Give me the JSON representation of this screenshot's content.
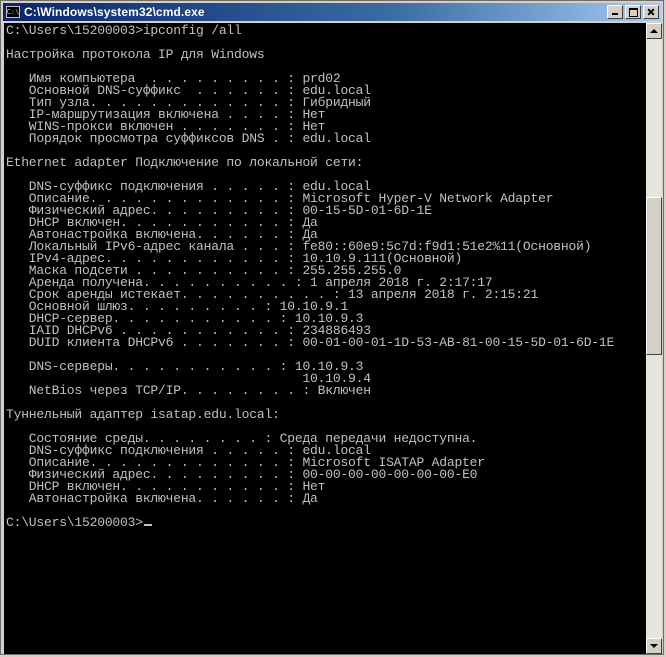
{
  "window": {
    "title": "C:\\Windows\\system32\\cmd.exe",
    "icon_text": "C:\\",
    "buttons": {
      "minimize": "minimize-icon",
      "maximize": "maximize-icon",
      "close": "close-icon"
    }
  },
  "colors": {
    "console_bg": "#000000",
    "console_text": "#c0c0c0",
    "titlebar": "#0a246a"
  },
  "terminal": {
    "prompt_command": "C:\\Users\\15200003>ipconfig /all",
    "output": "\nНастройка протокола IP для Windows\n\n   Имя компьютера  . . . . . . . . . : prd02\n   Основной DNS-суффикс  . . . . . . : edu.local\n   Тип узла. . . . . . . . . . . . . : Гибридный\n   IP-маршрутизация включена . . . . : Нет\n   WINS-прокси включен . . . . . . . : Нет\n   Порядок просмотра суффиксов DNS . : edu.local\n\nEthernet adapter Подключение по локальной сети:\n\n   DNS-суффикс подключения . . . . . : edu.local\n   Описание. . . . . . . . . . . . . : Microsoft Hyper-V Network Adapter\n   Физический адрес. . . . . . . . . : 00-15-5D-01-6D-1E\n   DHCP включен. . . . . . . . . . . : Да\n   Автонастройка включена. . . . . . : Да\n   Локальный IPv6-адрес канала . . . : fe80::60e9:5c7d:f9d1:51e2%11(Основной)\n   IPv4-адрес. . . . . . . . . . . . : 10.10.9.111(Основной)\n   Маска подсети . . . . . . . . . . : 255.255.255.0\n   Аренда получена. . . . . . . . . . : 1 апреля 2018 г. 2:17:17\n   Срок аренды истекает. . . . . . . . . . : 13 апреля 2018 г. 2:15:21\n   Основной шлюз. . . . . . . . . : 10.10.9.1\n   DHCP-сервер. . . . . . . . . . . : 10.10.9.3\n   IAID DHCPv6 . . . . . . . . . . . : 234886493\n   DUID клиента DHCPv6 . . . . . . . : 00-01-00-01-1D-53-AB-81-00-15-5D-01-6D-1E\n\n   DNS-серверы. . . . . . . . . . . : 10.10.9.3\n                                       10.10.9.4\n   NetBios через TCP/IP. . . . . . . . : Включен\n\nТуннельный адаптер isatap.edu.local:\n\n   Состояние среды. . . . . . . . : Среда передачи недоступна.\n   DNS-суффикс подключения . . . . . : edu.local\n   Описание. . . . . . . . . . . . . : Microsoft ISATAP Adapter\n   Физический адрес. . . . . . . . . : 00-00-00-00-00-00-00-E0\n   DHCP включен. . . . . . . . . . . : Нет\n   Автонастройка включена. . . . . . : Да\n",
    "final_prompt": "C:\\Users\\15200003>"
  }
}
